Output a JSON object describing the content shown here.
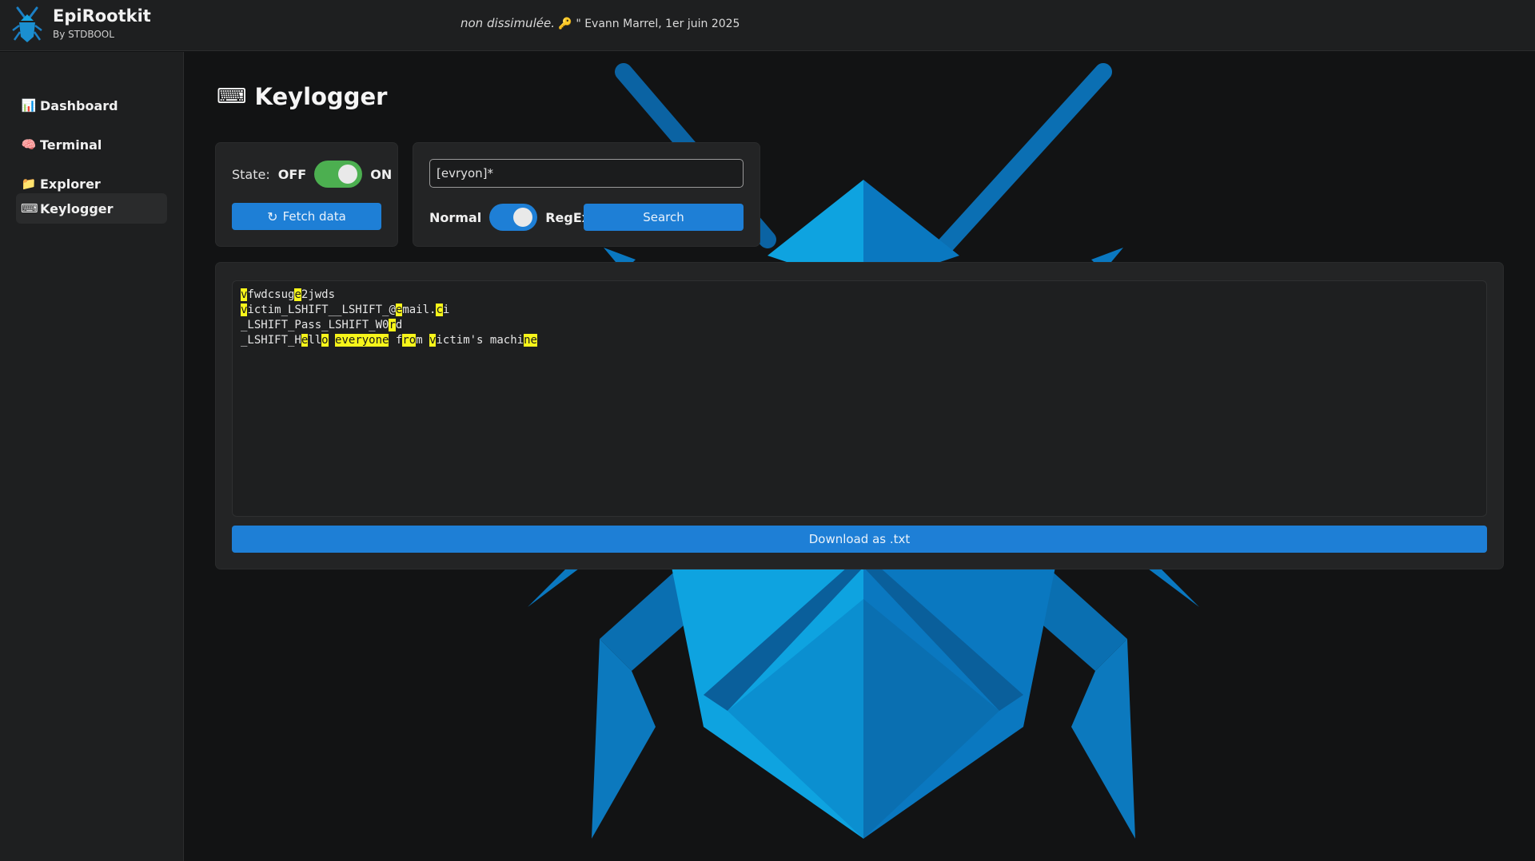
{
  "app": {
    "title": "EpiRootkit",
    "subtitle": "By STDBOOL"
  },
  "quote": {
    "text_italic": "non dissimulée.",
    "emoji": "🔑",
    "attribution": "\" Evann Marrel, 1er juin 2025"
  },
  "sidebar": {
    "items": [
      {
        "icon": "📊",
        "icon_name": "bar-chart-icon",
        "label": "Dashboard",
        "active": false
      },
      {
        "icon": "🧠",
        "icon_name": "brain-icon",
        "label": "Terminal",
        "active": false
      },
      {
        "icon": "📁",
        "icon_name": "folder-icon",
        "label": "Explorer",
        "active": false
      },
      {
        "icon": "⌨",
        "icon_name": "keyboard-icon",
        "label": "Keylogger",
        "active": true
      }
    ]
  },
  "page": {
    "title_icon": "⌨",
    "title": "Keylogger"
  },
  "state_panel": {
    "label": "State:",
    "off": "OFF",
    "on": "ON",
    "toggle_on": true,
    "fetch_icon": "↻",
    "fetch_label": "Fetch data"
  },
  "search_panel": {
    "query": "[evryon]*",
    "mode_normal": "Normal",
    "mode_regex": "RegEx",
    "regex_on": true,
    "search_label": "Search"
  },
  "log": {
    "lines": [
      [
        [
          "v",
          true
        ],
        [
          "fwdcsug",
          false
        ],
        [
          "e",
          true
        ],
        [
          "2jwds",
          false
        ]
      ],
      [
        [
          "v",
          true
        ],
        [
          "ictim_LSHIFT__LSHIFT_@",
          false
        ],
        [
          "e",
          true
        ],
        [
          "mail.",
          false
        ],
        [
          "c",
          true
        ],
        [
          "i",
          false
        ]
      ],
      [
        [
          "_LSHIFT_Pass_LSHIFT_W0",
          false
        ],
        [
          "r",
          true
        ],
        [
          "d",
          false
        ]
      ],
      [
        [
          "_LSHIFT_H",
          false
        ],
        [
          "e",
          true
        ],
        [
          "ll",
          false
        ],
        [
          "o",
          true
        ],
        [
          " ",
          false
        ],
        [
          "everyone",
          true
        ],
        [
          " f",
          false
        ],
        [
          "ro",
          true
        ],
        [
          "m ",
          false
        ],
        [
          "v",
          true
        ],
        [
          "ictim's machi",
          false
        ],
        [
          "ne",
          true
        ]
      ]
    ],
    "download_label": "Download as .txt"
  },
  "colors": {
    "accent": "#1e7fd6",
    "toggle_green": "#4caf50",
    "highlight": "#f7f51a",
    "bug_light": "#0ea3e0",
    "bug_dark": "#0a5f9b"
  }
}
